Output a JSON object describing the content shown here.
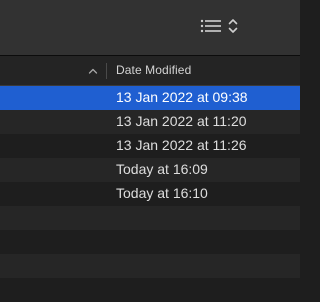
{
  "toolbar": {
    "view_options_icon": "list-lines-icon",
    "chevron_icon": "up-down-chevron-icon"
  },
  "column_header": {
    "label": "Date Modified",
    "sort_icon": "chevron-up-icon"
  },
  "rows": [
    {
      "date": "13 Jan 2022 at 09:38",
      "selected": true
    },
    {
      "date": "13 Jan 2022 at 11:20",
      "selected": false
    },
    {
      "date": "13 Jan 2022 at 11:26",
      "selected": false
    },
    {
      "date": "Today at 16:09",
      "selected": false
    },
    {
      "date": "Today at 16:10",
      "selected": false
    },
    {
      "date": "",
      "selected": false
    },
    {
      "date": "",
      "selected": false
    },
    {
      "date": "",
      "selected": false
    },
    {
      "date": "",
      "selected": false
    }
  ],
  "colors": {
    "selection": "#1f5fd1",
    "background": "#1e1e1e",
    "toolbar": "#323232"
  }
}
